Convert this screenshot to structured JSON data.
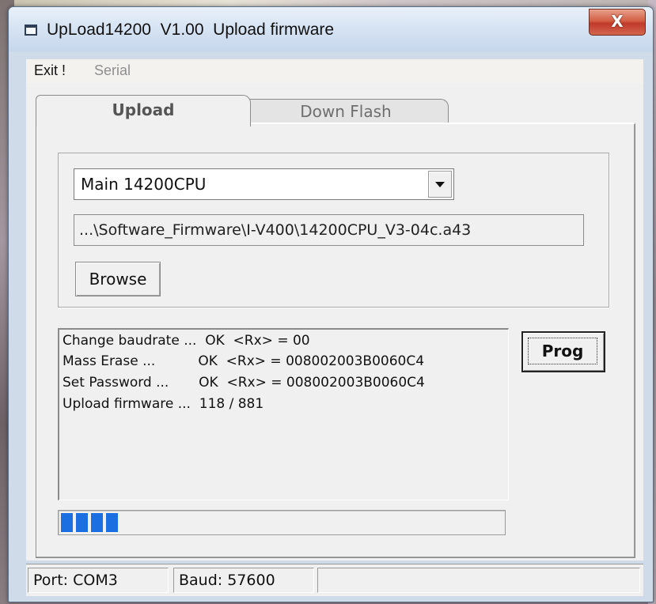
{
  "window": {
    "title": "UpLoad14200  V1.00  Upload firmware",
    "close_glyph": "X"
  },
  "menu": {
    "items": [
      {
        "label": "Exit !",
        "enabled": true
      },
      {
        "label": "Serial",
        "enabled": false
      }
    ]
  },
  "tabs": [
    {
      "label": "Upload",
      "active": true
    },
    {
      "label": "Down Flash",
      "active": false
    }
  ],
  "upload": {
    "target_select": "Main  14200CPU",
    "file_path": "...\\Software_Firmware\\I-V400\\14200CPU_V3-04c.a43",
    "browse_label": "Browse",
    "prog_label": "Prog",
    "log_lines": [
      "Change baudrate ...  OK  <Rx> = 00",
      "Mass Erase ...          OK  <Rx> = 008002003B0060C4",
      "Set Password ...       OK  <Rx> = 008002003B0060C4",
      "Upload firmware ...  118 / 881"
    ],
    "progress": {
      "current": 118,
      "total": 881,
      "fraction": 0.134
    }
  },
  "status": {
    "port": "Port: COM3",
    "baud": "Baud: 57600",
    "extra": ""
  },
  "colors": {
    "progress_fill": "#1c6fe0",
    "close_button": "#c0392b"
  },
  "icons": {
    "app": "app-window-icon",
    "dropdown": "chevron-down-icon"
  }
}
